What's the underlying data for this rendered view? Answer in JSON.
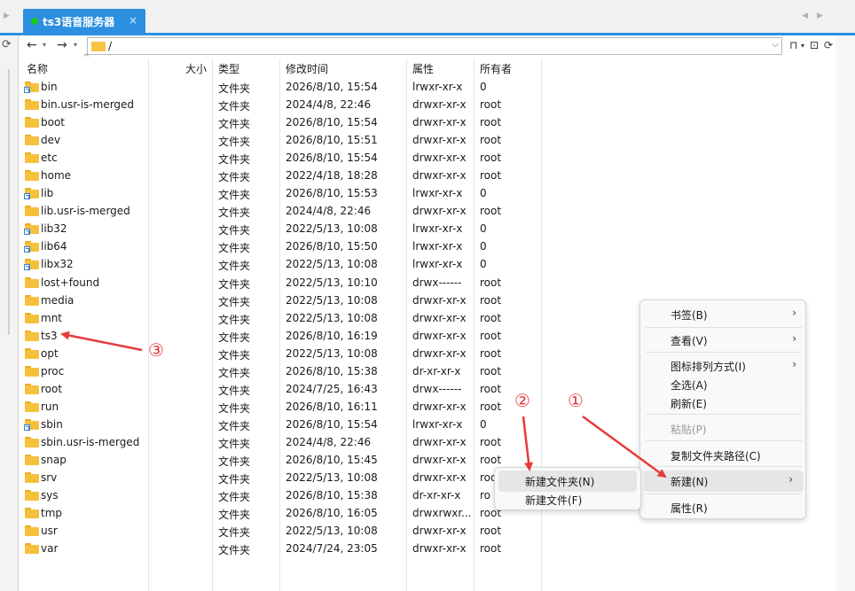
{
  "tab": {
    "title": "ts3语音服务器",
    "close": "×",
    "status_color": "#1ec81e"
  },
  "toolbar": {
    "back": "←",
    "forward": "→",
    "path": "/",
    "bookmark": "⊓",
    "refresh": "C"
  },
  "columns": {
    "name": "名称",
    "size": "大小",
    "type": "类型",
    "mtime": "修改时间",
    "perm": "属性",
    "owner": "所有者"
  },
  "files": [
    {
      "name": "bin",
      "type": "文件夹",
      "mtime": "2026/8/10, 15:54",
      "perm": "lrwxr-xr-x",
      "owner": "0",
      "link": true
    },
    {
      "name": "bin.usr-is-merged",
      "type": "文件夹",
      "mtime": "2024/4/8, 22:46",
      "perm": "drwxr-xr-x",
      "owner": "root",
      "link": false
    },
    {
      "name": "boot",
      "type": "文件夹",
      "mtime": "2026/8/10, 15:54",
      "perm": "drwxr-xr-x",
      "owner": "root",
      "link": false
    },
    {
      "name": "dev",
      "type": "文件夹",
      "mtime": "2026/8/10, 15:51",
      "perm": "drwxr-xr-x",
      "owner": "root",
      "link": false
    },
    {
      "name": "etc",
      "type": "文件夹",
      "mtime": "2026/8/10, 15:54",
      "perm": "drwxr-xr-x",
      "owner": "root",
      "link": false
    },
    {
      "name": "home",
      "type": "文件夹",
      "mtime": "2022/4/18, 18:28",
      "perm": "drwxr-xr-x",
      "owner": "root",
      "link": false
    },
    {
      "name": "lib",
      "type": "文件夹",
      "mtime": "2026/8/10, 15:53",
      "perm": "lrwxr-xr-x",
      "owner": "0",
      "link": true
    },
    {
      "name": "lib.usr-is-merged",
      "type": "文件夹",
      "mtime": "2024/4/8, 22:46",
      "perm": "drwxr-xr-x",
      "owner": "root",
      "link": false
    },
    {
      "name": "lib32",
      "type": "文件夹",
      "mtime": "2022/5/13, 10:08",
      "perm": "lrwxr-xr-x",
      "owner": "0",
      "link": true
    },
    {
      "name": "lib64",
      "type": "文件夹",
      "mtime": "2026/8/10, 15:50",
      "perm": "lrwxr-xr-x",
      "owner": "0",
      "link": true
    },
    {
      "name": "libx32",
      "type": "文件夹",
      "mtime": "2022/5/13, 10:08",
      "perm": "lrwxr-xr-x",
      "owner": "0",
      "link": true
    },
    {
      "name": "lost+found",
      "type": "文件夹",
      "mtime": "2022/5/13, 10:10",
      "perm": "drwx------",
      "owner": "root",
      "link": false
    },
    {
      "name": "media",
      "type": "文件夹",
      "mtime": "2022/5/13, 10:08",
      "perm": "drwxr-xr-x",
      "owner": "root",
      "link": false
    },
    {
      "name": "mnt",
      "type": "文件夹",
      "mtime": "2022/5/13, 10:08",
      "perm": "drwxr-xr-x",
      "owner": "root",
      "link": false
    },
    {
      "name": "ts3",
      "type": "文件夹",
      "mtime": "2026/8/10, 16:19",
      "perm": "drwxr-xr-x",
      "owner": "root",
      "link": false
    },
    {
      "name": "opt",
      "type": "文件夹",
      "mtime": "2022/5/13, 10:08",
      "perm": "drwxr-xr-x",
      "owner": "root",
      "link": false
    },
    {
      "name": "proc",
      "type": "文件夹",
      "mtime": "2026/8/10, 15:38",
      "perm": "dr-xr-xr-x",
      "owner": "root",
      "link": false
    },
    {
      "name": "root",
      "type": "文件夹",
      "mtime": "2024/7/25, 16:43",
      "perm": "drwx------",
      "owner": "root",
      "link": false
    },
    {
      "name": "run",
      "type": "文件夹",
      "mtime": "2026/8/10, 16:11",
      "perm": "drwxr-xr-x",
      "owner": "root",
      "link": false
    },
    {
      "name": "sbin",
      "type": "文件夹",
      "mtime": "2026/8/10, 15:54",
      "perm": "lrwxr-xr-x",
      "owner": "0",
      "link": true
    },
    {
      "name": "sbin.usr-is-merged",
      "type": "文件夹",
      "mtime": "2024/4/8, 22:46",
      "perm": "drwxr-xr-x",
      "owner": "root",
      "link": false
    },
    {
      "name": "snap",
      "type": "文件夹",
      "mtime": "2026/8/10, 15:45",
      "perm": "drwxr-xr-x",
      "owner": "root",
      "link": false
    },
    {
      "name": "srv",
      "type": "文件夹",
      "mtime": "2022/5/13, 10:08",
      "perm": "drwxr-xr-x",
      "owner": "roo",
      "link": false
    },
    {
      "name": "sys",
      "type": "文件夹",
      "mtime": "2026/8/10, 15:38",
      "perm": "dr-xr-xr-x",
      "owner": "ro",
      "link": false
    },
    {
      "name": "tmp",
      "type": "文件夹",
      "mtime": "2026/8/10, 16:05",
      "perm": "drwxrwxr...",
      "owner": "root",
      "link": false
    },
    {
      "name": "usr",
      "type": "文件夹",
      "mtime": "2022/5/13, 10:08",
      "perm": "drwxr-xr-x",
      "owner": "root",
      "link": false
    },
    {
      "name": "var",
      "type": "文件夹",
      "mtime": "2024/7/24, 23:05",
      "perm": "drwxr-xr-x",
      "owner": "root",
      "link": false
    }
  ],
  "context_menu": {
    "bookmark": "书签(B)",
    "view": "查看(V)",
    "sort_icons": "图标排列方式(I)",
    "select_all": "全选(A)",
    "refresh": "刷新(E)",
    "paste": "粘贴(P)",
    "copy_path": "复制文件夹路径(C)",
    "new": "新建(N)",
    "properties": "属性(R)",
    "submenu_arrow": "›"
  },
  "new_submenu": {
    "new_folder": "新建文件夹(N)",
    "new_file": "新建文件(F)"
  },
  "annotations": {
    "step1": "①",
    "step2": "②",
    "step3": "③",
    "color": "#e53b3b"
  }
}
